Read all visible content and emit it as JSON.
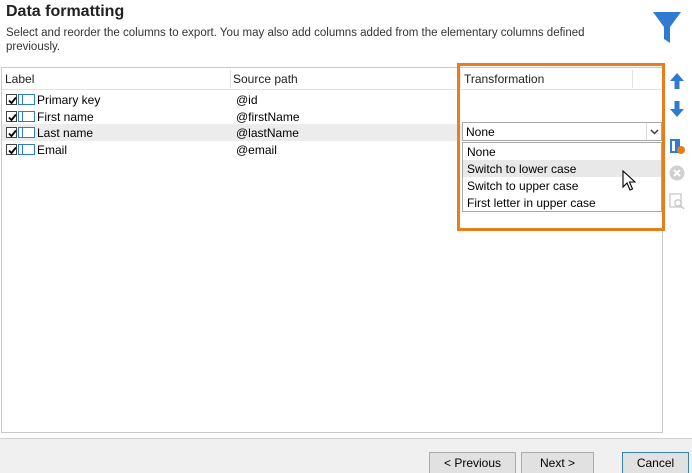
{
  "header": {
    "title": "Data formatting",
    "subtitle": "Select and reorder the columns to export. You may also add columns added from the elementary columns defined previously."
  },
  "grid": {
    "columns": [
      "Label",
      "Source path",
      "Transformation"
    ],
    "rows": [
      {
        "label": "Primary key",
        "source": "@id",
        "checked": true
      },
      {
        "label": "First name",
        "source": "@firstName",
        "checked": true
      },
      {
        "label": "Last name",
        "source": "@lastName",
        "checked": true
      },
      {
        "label": "Email",
        "source": "@email",
        "checked": true
      }
    ]
  },
  "transformation": {
    "selected": "None",
    "options": [
      "None",
      "Switch to lower case",
      "Switch to upper case",
      "First letter in upper case"
    ],
    "hovered_option": "Switch to lower case"
  },
  "side_toolbar": {
    "icons": [
      "move-up-icon",
      "move-down-icon",
      "add-column-icon",
      "delete-icon",
      "detail-icon"
    ]
  },
  "footer": {
    "previous_label": "< Previous",
    "next_label": "Next >",
    "cancel_label": "Cancel"
  },
  "colors": {
    "accent_orange": "#e87d1e",
    "icon_blue": "#2f7bd2",
    "disabled_gray": "#c8c8c8"
  }
}
